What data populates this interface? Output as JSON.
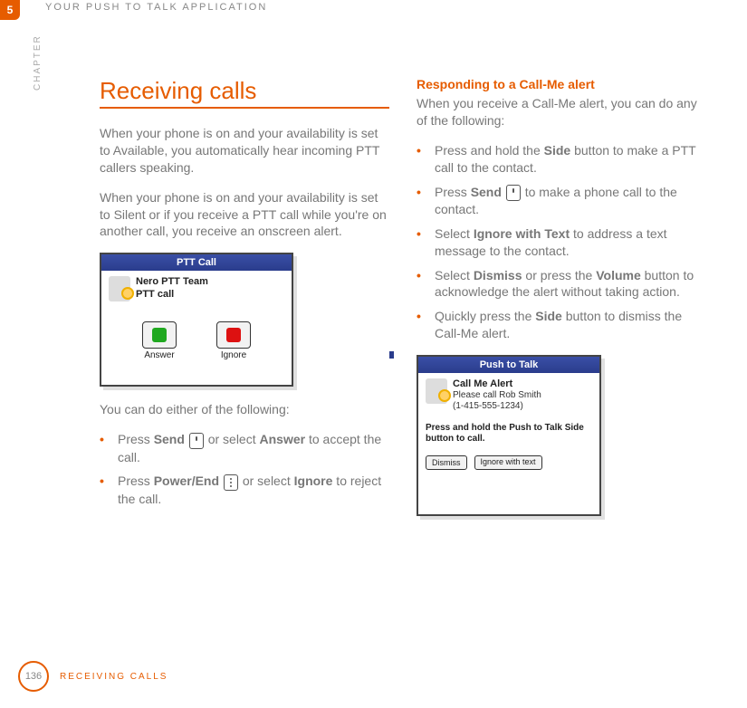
{
  "header": {
    "chapter_number": "5",
    "chapter_word": "CHAPTER",
    "running_title": "YOUR PUSH TO TALK APPLICATION"
  },
  "left": {
    "heading": "Receiving calls",
    "p1": "When your phone is on and your availability is set to Available, you automatically hear incoming PTT callers speaking.",
    "p2": "When your phone is on and your availability is set to Silent or if you receive a PTT call while you're on another call, you receive an onscreen alert.",
    "phone": {
      "title": "PTT Call",
      "line1": "Nero PTT Team",
      "line2": "PTT call",
      "btn1": "Answer",
      "btn2": "Ignore"
    },
    "p3": "You can do either of the following:",
    "items": {
      "i1a": "Press ",
      "i1b": "Send",
      "i1c": " or select ",
      "i1d": "Answer",
      "i1e": " to accept the call.",
      "i2a": "Press ",
      "i2b": "Power/End",
      "i2c": " or select ",
      "i2d": "Ignore",
      "i2e": " to reject the call."
    }
  },
  "right": {
    "subhead": "Responding to a Call-Me alert",
    "intro": "When you receive a Call-Me alert, you can do any of the following:",
    "items": {
      "i1a": "Press and hold the ",
      "i1b": "Side",
      "i1c": " button to make a PTT call to the contact.",
      "i2a": "Press ",
      "i2b": "Send",
      "i2c": " to make a phone call to the contact.",
      "i3a": "Select ",
      "i3b": "Ignore with Text",
      "i3c": " to address a text message to the contact.",
      "i4a": "Select ",
      "i4b": "Dismiss",
      "i4c": " or press the ",
      "i4d": "Volume",
      "i4e": " button to acknowledge the alert without taking action.",
      "i5a": "Quickly press the ",
      "i5b": "Side",
      "i5c": " button to dismiss the Call-Me alert."
    },
    "phone": {
      "title": "Push to Talk",
      "line1": "Call Me Alert",
      "line2": "Please call Rob Smith",
      "line3": "(1-415-555-1234)",
      "hint": "Press and hold the Push to Talk Side button to call.",
      "btn1": "Dismiss",
      "btn2": "Ignore with text"
    }
  },
  "footer": {
    "page": "136",
    "section": "RECEIVING CALLS"
  }
}
